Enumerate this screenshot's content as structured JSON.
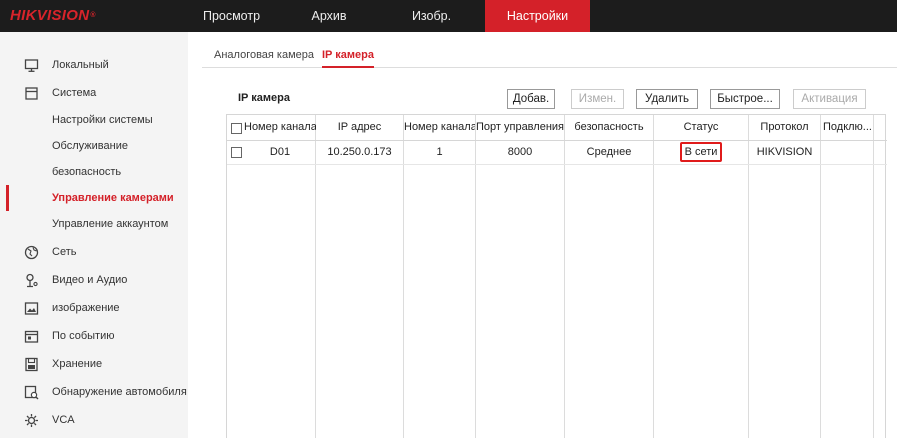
{
  "brand": {
    "logo": "HIKVISION",
    "reg": "®"
  },
  "topnav": [
    {
      "label": "Просмотр",
      "active": false
    },
    {
      "label": "Архив",
      "active": false
    },
    {
      "label": "Изобр.",
      "active": false
    },
    {
      "label": "Настройки",
      "active": true
    }
  ],
  "sidebar": {
    "items": [
      {
        "label": "Локальный",
        "icon": "monitor-icon"
      },
      {
        "label": "Система",
        "icon": "system-icon"
      },
      {
        "label": "Настройки системы"
      },
      {
        "label": "Обслуживание"
      },
      {
        "label": "безопасность"
      },
      {
        "label": "Управление камерами",
        "active": true
      },
      {
        "label": "Управление аккаунтом"
      },
      {
        "label": "Сеть",
        "icon": "globe-icon"
      },
      {
        "label": "Видео и Аудио",
        "icon": "video-audio-icon"
      },
      {
        "label": "изображение",
        "icon": "image-icon"
      },
      {
        "label": "По событию",
        "icon": "event-icon"
      },
      {
        "label": "Хранение",
        "icon": "storage-icon"
      },
      {
        "label": "Обнаружение автомобиля",
        "icon": "vehicle-detection-icon"
      },
      {
        "label": "VCA",
        "icon": "vca-icon"
      }
    ]
  },
  "tabs": [
    {
      "label": "Аналоговая камера",
      "active": false
    },
    {
      "label": "IP камера",
      "active": true
    }
  ],
  "section": {
    "title": "IP камера",
    "buttons": {
      "add": "Добав.",
      "edit": "Измен.",
      "delete": "Удалить",
      "quick": "Быстрое...",
      "activate": "Активация"
    }
  },
  "table": {
    "headers": [
      "Номер канала",
      "IP адрес",
      "Номер канала",
      "Порт управления",
      "безопасность",
      "Статус",
      "Протокол",
      "Подклю..."
    ],
    "rows": [
      {
        "channel": "D01",
        "ip": "10.250.0.173",
        "channel_no": "1",
        "port": "8000",
        "security": "Среднее",
        "status": "В сети",
        "protocol": "HIKVISION",
        "connect": ""
      }
    ]
  },
  "colors": {
    "accent": "#d42129",
    "topbar": "#1c1c1c",
    "sidebar": "#f4f4f4",
    "status_border": "#e01b1b"
  }
}
